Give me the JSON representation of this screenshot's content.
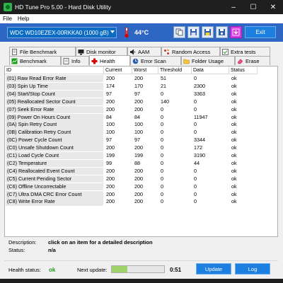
{
  "window": {
    "title": "HD Tune Pro 5.00 - Hard Disk Utility",
    "controls": {
      "minimize": "–",
      "maximize": "☐",
      "close": "✕"
    }
  },
  "menu": {
    "file": "File",
    "help": "Help"
  },
  "toolbar": {
    "drive": "WDC WD10EZEX-00RKKA0     (1000 gB)",
    "temperature": "44°C",
    "exit_label": "Exit",
    "buttons": [
      "copy-icon",
      "save-icon",
      "save-all-icon",
      "disk-icon",
      "download-icon"
    ]
  },
  "tabs_top": [
    {
      "label": "File Benchmark",
      "icon": "file-icon"
    },
    {
      "label": "Disk monitor",
      "icon": "monitor-icon"
    },
    {
      "label": "AAM",
      "icon": "speaker-icon"
    },
    {
      "label": "Random Access",
      "icon": "random-icon"
    },
    {
      "label": "Extra tests",
      "icon": "tests-icon"
    }
  ],
  "tabs_bottom": [
    {
      "label": "Benchmark",
      "icon": "benchmark-icon"
    },
    {
      "label": "Info",
      "icon": "info-icon"
    },
    {
      "label": "Health",
      "icon": "health-icon"
    },
    {
      "label": "Error Scan",
      "icon": "scan-icon"
    },
    {
      "label": "Folder Usage",
      "icon": "folder-icon"
    },
    {
      "label": "Erase",
      "icon": "erase-icon"
    }
  ],
  "table": {
    "headers": [
      "ID",
      "Current",
      "Worst",
      "Threshold",
      "Data",
      "Status"
    ],
    "rows": [
      [
        "(01) Raw Read Error Rate",
        "200",
        "200",
        "51",
        "0",
        "ok"
      ],
      [
        "(03) Spin Up Time",
        "174",
        "170",
        "21",
        "2300",
        "ok"
      ],
      [
        "(04) Start/Stop Count",
        "97",
        "97",
        "0",
        "3363",
        "ok"
      ],
      [
        "(05) Reallocated Sector Count",
        "200",
        "200",
        "140",
        "0",
        "ok"
      ],
      [
        "(07) Seek Error Rate",
        "200",
        "200",
        "0",
        "0",
        "ok"
      ],
      [
        "(09) Power On Hours Count",
        "84",
        "84",
        "0",
        "11947",
        "ok"
      ],
      [
        "(0A) Spin Retry Count",
        "100",
        "100",
        "0",
        "0",
        "ok"
      ],
      [
        "(0B) Calibration Retry Count",
        "100",
        "100",
        "0",
        "0",
        "ok"
      ],
      [
        "(0C) Power Cycle Count",
        "97",
        "97",
        "0",
        "3344",
        "ok"
      ],
      [
        "(C0) Unsafe Shutdown Count",
        "200",
        "200",
        "0",
        "172",
        "ok"
      ],
      [
        "(C1) Load Cycle Count",
        "199",
        "199",
        "0",
        "3190",
        "ok"
      ],
      [
        "(C2) Temperature",
        "99",
        "88",
        "0",
        "44",
        "ok"
      ],
      [
        "(C4) Reallocated Event Count",
        "200",
        "200",
        "0",
        "0",
        "ok"
      ],
      [
        "(C5) Current Pending Sector",
        "200",
        "200",
        "0",
        "0",
        "ok"
      ],
      [
        "(C6) Offline Uncorrectable",
        "200",
        "200",
        "0",
        "0",
        "ok"
      ],
      [
        "(C7) Ultra DMA CRC Error Count",
        "200",
        "200",
        "0",
        "0",
        "ok"
      ],
      [
        "(C8) Write Error Rate",
        "200",
        "200",
        "0",
        "0",
        "ok"
      ]
    ]
  },
  "description": {
    "desc_label": "Description:",
    "desc_value": "click on an item for a detailed description",
    "status_label": "Status:",
    "status_value": "n/a"
  },
  "status_bar": {
    "health_label": "Health status:",
    "health_value": "ok",
    "next_update_label": "Next update:",
    "progress": 0.3,
    "countdown": "0:51",
    "update_label": "Update",
    "log_label": "Log"
  },
  "colors": {
    "toolbar_bg": "#2e66c4",
    "ok_green": "#1a9a1a",
    "progress_fill": "#9fd46a",
    "button_blue": "#1d7fe0"
  }
}
